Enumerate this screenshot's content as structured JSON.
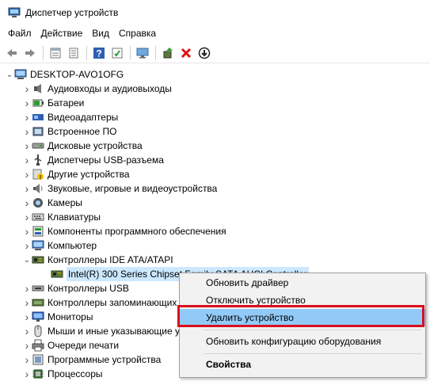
{
  "window": {
    "title": "Диспетчер устройств"
  },
  "menubar": {
    "items": [
      "Файл",
      "Действие",
      "Вид",
      "Справка"
    ]
  },
  "toolbar": {
    "buttons": [
      "back-icon",
      "forward-icon",
      "properties-icon",
      "view-icon",
      "help-icon",
      "refresh-icon",
      "monitor-icon",
      "update-driver-icon",
      "uninstall-icon",
      "download-icon"
    ]
  },
  "tree": {
    "root": "DESKTOP-AVO1OFG",
    "items": [
      {
        "label": "Аудиовходы и аудиовыходы",
        "icon": "audio-icon"
      },
      {
        "label": "Батареи",
        "icon": "battery-icon"
      },
      {
        "label": "Видеоадаптеры",
        "icon": "display-adapter-icon"
      },
      {
        "label": "Встроенное ПО",
        "icon": "firmware-icon"
      },
      {
        "label": "Дисковые устройства",
        "icon": "disk-icon"
      },
      {
        "label": "Диспетчеры USB-разъема",
        "icon": "usb-connector-icon"
      },
      {
        "label": "Другие устройства",
        "icon": "unknown-device-icon"
      },
      {
        "label": "Звуковые, игровые и видеоустройства",
        "icon": "sound-icon"
      },
      {
        "label": "Камеры",
        "icon": "camera-icon"
      },
      {
        "label": "Клавиатуры",
        "icon": "keyboard-icon"
      },
      {
        "label": "Компоненты программного обеспечения",
        "icon": "software-component-icon"
      },
      {
        "label": "Компьютер",
        "icon": "computer-icon"
      },
      {
        "label": "Контроллеры IDE ATA/ATAPI",
        "icon": "ide-controller-icon",
        "expanded": true
      },
      {
        "label": "Intel(R) 300 Series Chipset Family SATA AHCI Controller",
        "icon": "chip-icon",
        "child": true,
        "selected": true
      },
      {
        "label": "Контроллеры USB",
        "icon": "usb-icon"
      },
      {
        "label": "Контроллеры запоминающих устройств",
        "icon": "storage-controller-icon"
      },
      {
        "label": "Мониторы",
        "icon": "monitor-icon"
      },
      {
        "label": "Мыши и иные указывающие устройства",
        "icon": "mouse-icon"
      },
      {
        "label": "Очереди печати",
        "icon": "printer-icon"
      },
      {
        "label": "Программные устройства",
        "icon": "software-device-icon"
      },
      {
        "label": "Процессоры",
        "icon": "cpu-icon"
      }
    ]
  },
  "context_menu": {
    "update_driver": "Обновить драйвер",
    "disable_device": "Отключить устройство",
    "uninstall_device": "Удалить устройство",
    "scan_hardware": "Обновить конфигурацию оборудования",
    "properties": "Свойства"
  },
  "colors": {
    "selection": "#cce8ff",
    "menu_highlight": "#91c9f7",
    "annotation_box": "#d90f1d"
  }
}
